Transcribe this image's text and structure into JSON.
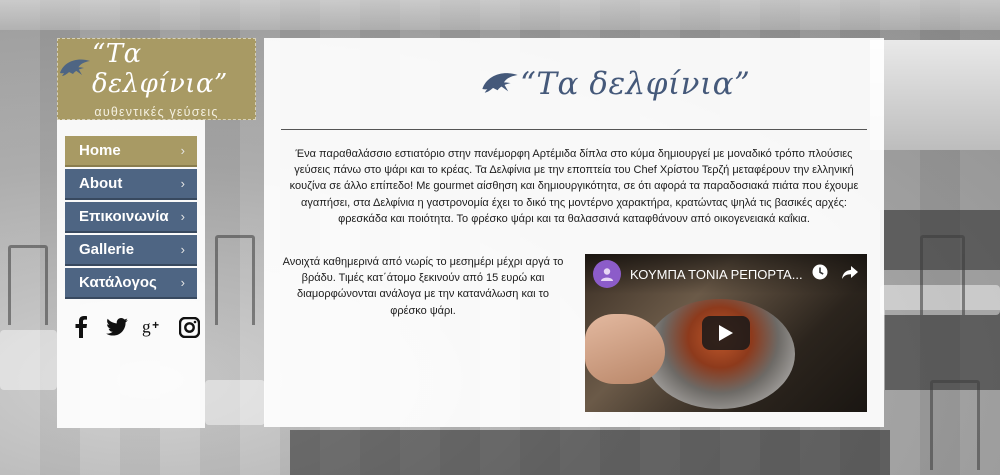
{
  "brand": {
    "name": "“Τα δελφίνια”",
    "tagline": "αυθεντικές γεύσεις",
    "colors": {
      "gold": "#a89a64",
      "navy": "#4e6583",
      "logo_text": "#45597a"
    }
  },
  "nav": {
    "items": [
      {
        "label": "Home",
        "active": true
      },
      {
        "label": "About"
      },
      {
        "label": "Επικοινωνία"
      },
      {
        "label": "Gallerie"
      },
      {
        "label": "Κατάλογος"
      }
    ],
    "chevron": "›"
  },
  "social": [
    "facebook-icon",
    "twitter-icon",
    "google-plus-icon",
    "instagram-icon"
  ],
  "main": {
    "logo_text": "“Τα δελφίνια”",
    "intro": "Ένα παραθαλάσσιο εστιατόριο στην πανέμορφη Αρτέμιδα δίπλα στο κύμα δημιουργεί με μοναδικό τρόπο πλούσιες γεύσεις πάνω στο ψάρι και το κρέας. Τα Δελφίνια με την εποπτεία του Chef  Χρίστου Τερζή μεταφέρουν την ελληνική κουζίνα σε άλλο επίπεδο! Με gourmet αίσθηση και δημιουργικότητα, σε ότι αφορά τα παραδοσιακά πιάτα που έχουμε αγαπήσει, στα Δελφίνια η γαστρονομία έχει το δικό της μοντέρνο χαρακτήρα, κρατώντας ψηλά τις βασικές αρχές: φρεσκάδα και ποιότητα. Το φρέσκο ψάρι και τα θαλασσινά καταφθάνουν από οικογενειακά καΐκια.",
    "hours": "Ανοιχτά καθημερινά από νωρίς το μεσημέρι μέχρι αργά το βράδυ. Τιμές κατ΄άτομο ξεκινούν από 15 ευρώ και διαμορφώνονται ανάλογα με την κατανάλωση και το φρέσκο ψάρι.",
    "video": {
      "title": "ΚΟΥΜΠΑ ΤΟΝΙΑ ΡΕΠΟΡΤΑ..."
    }
  }
}
